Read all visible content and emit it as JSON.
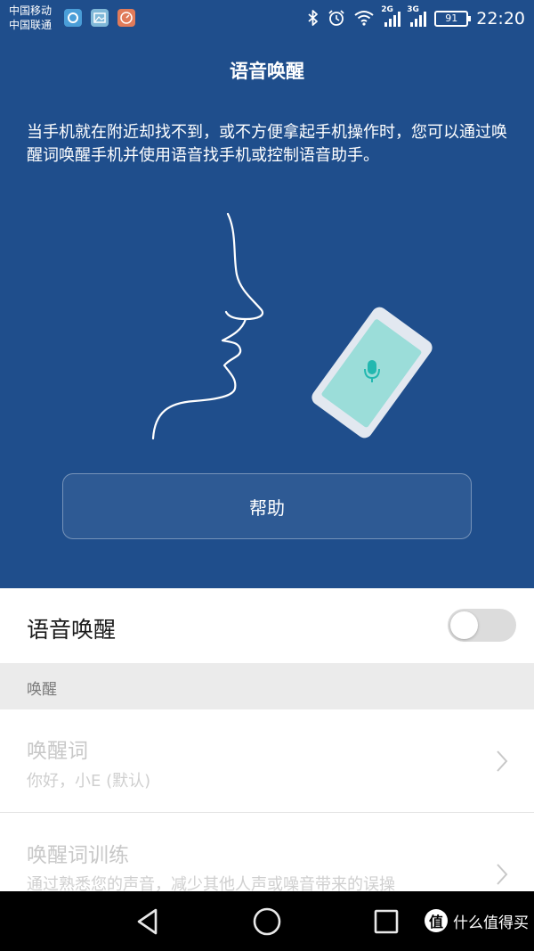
{
  "status_bar": {
    "carrier_1": "中国移动",
    "carrier_2": "中国联通",
    "network_1": "2G",
    "network_2": "3G",
    "battery": "91",
    "time": "22:20",
    "icons": [
      "browser-app-icon",
      "gallery-app-icon",
      "speed-app-icon",
      "bluetooth-icon",
      "alarm-icon",
      "wifi-icon"
    ]
  },
  "header": {
    "title": "语音唤醒",
    "description": "当手机就在附近却找不到，或不方便拿起手机操作时，您可以通过唤醒词唤醒手机并使用语音找手机或控制语音助手。",
    "help_button": "帮助"
  },
  "settings": {
    "voice_wakeup_label": "语音唤醒",
    "voice_wakeup_enabled": false,
    "section_wakeup": "唤醒",
    "items": [
      {
        "title": "唤醒词",
        "subtitle": "你好，小E (默认)"
      },
      {
        "title": "唤醒词训练",
        "subtitle": "通过熟悉您的声音，减少其他人声或噪音带来的误操"
      }
    ]
  },
  "nav_bar": {
    "buttons": [
      "back-icon",
      "home-icon",
      "recents-icon"
    ],
    "watermark_badge": "值",
    "watermark_text": "什么值得买"
  },
  "colors": {
    "header_bg": "#1f4e8c",
    "accent_teal": "#22b8b0",
    "switch_off": "#dcdcdc"
  }
}
